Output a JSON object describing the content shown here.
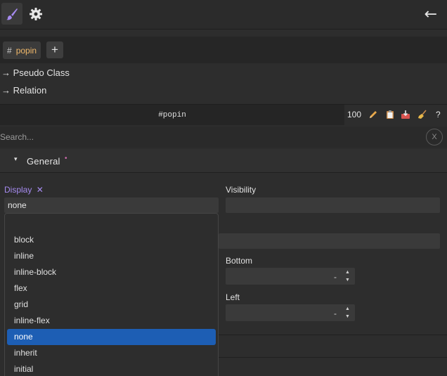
{
  "toolbar": {
    "style_tool_icon": "paintbrush-icon",
    "settings_icon": "gear-icon",
    "back_icon": "arrow-left-icon",
    "back_label": "←"
  },
  "selector": {
    "tag_hash": "#",
    "tag_name": "popin",
    "add_label": "+"
  },
  "expanders": {
    "pseudo_class": "→ Pseudo Class",
    "relation": "→ Relation"
  },
  "selector_bar": {
    "value": "#popin",
    "count": "100",
    "icons": [
      "pencil-icon",
      "clipboard-icon",
      "inbox-icon",
      "broom-icon"
    ],
    "help_label": "?"
  },
  "search": {
    "placeholder": "Search...",
    "clear_label": "X"
  },
  "section": {
    "caret": "▾",
    "label": "General",
    "dot": "•"
  },
  "fields": {
    "display_label": "Display",
    "display_remove": "✕",
    "display_value": "none",
    "visibility_label": "Visibility",
    "bottom_label": "Bottom",
    "bottom_value": "-",
    "left_label": "Left",
    "left_value": "-"
  },
  "dropdown": {
    "options": [
      "block",
      "inline",
      "inline-block",
      "flex",
      "grid",
      "inline-flex",
      "none",
      "inherit",
      "initial"
    ],
    "selected": "none"
  },
  "colors": {
    "accent_purple": "#a68bf0",
    "selector_orange": "#f0b86a",
    "selected_blue": "#1d5eb4",
    "dot_pink": "#d36bb0"
  }
}
